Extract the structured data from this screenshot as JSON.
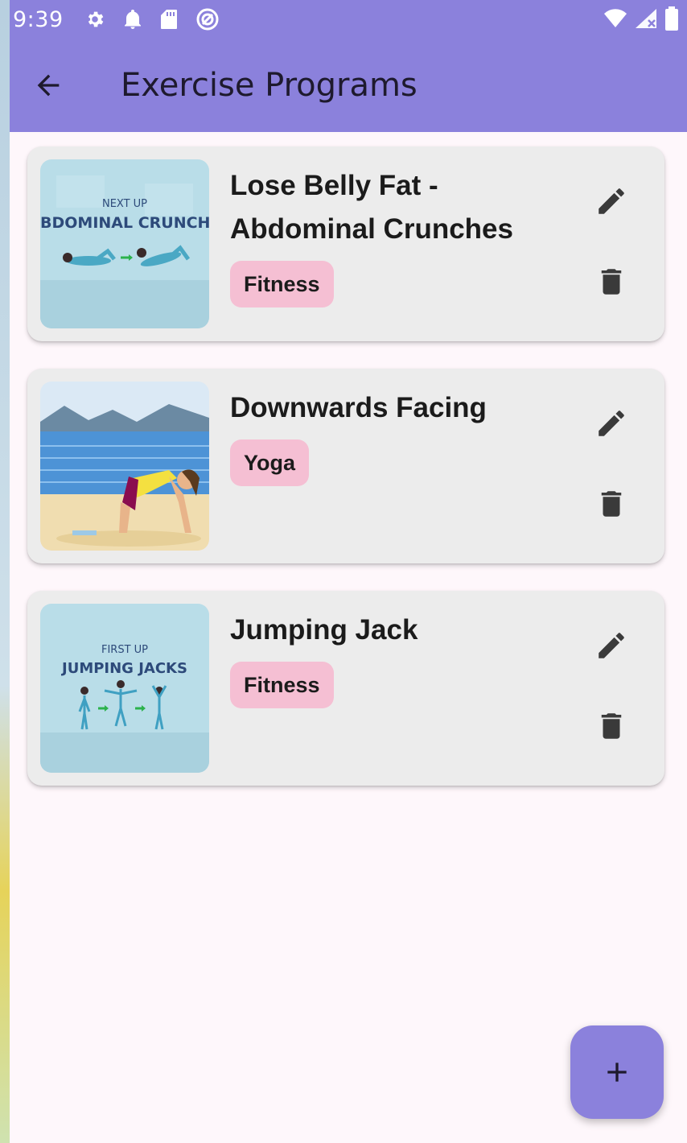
{
  "status_bar": {
    "time": "9:39",
    "icons_left": [
      "gear-icon",
      "bell-icon",
      "sd-card-icon",
      "sync-icon"
    ],
    "icons_right": [
      "wifi-icon",
      "signal-icon",
      "battery-icon"
    ]
  },
  "app_bar": {
    "title": "Exercise Programs",
    "back_icon": "arrow-back-icon",
    "color": "#8b81dc"
  },
  "programs": [
    {
      "title": "Lose Belly Fat - Abdominal Crunches",
      "category": "Fitness",
      "thumb_caption_top": "NEXT UP",
      "thumb_caption_main": "BDOMINAL CRUNCHI",
      "edit_icon": "pencil-icon",
      "delete_icon": "trash-icon"
    },
    {
      "title": "Downwards Facing",
      "category": "Yoga",
      "edit_icon": "pencil-icon",
      "delete_icon": "trash-icon"
    },
    {
      "title": "Jumping Jack",
      "category": "Fitness",
      "thumb_caption_top": "FIRST UP",
      "thumb_caption_main": "JUMPING JACKS",
      "edit_icon": "pencil-icon",
      "delete_icon": "trash-icon"
    }
  ],
  "fab": {
    "icon": "plus-icon"
  },
  "colors": {
    "accent": "#8b81dc",
    "chip": "#f5bfd3",
    "card": "#ececec"
  }
}
